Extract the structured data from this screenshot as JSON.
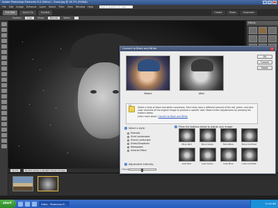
{
  "window": {
    "title": "Adobe Photoshop Elements 8.0 (Editor) - Snow.jpg @ 16.7% (RGB/8)",
    "min": "_",
    "max": "□",
    "close": "x"
  },
  "menu": {
    "items": [
      "File",
      "Edit",
      "Image",
      "Enhance",
      "Layer",
      "Select",
      "Filter",
      "View",
      "Window",
      "Help"
    ],
    "help_placeholder": "Type a question for help"
  },
  "tabs": {
    "full_edit": "Full Edit",
    "quick_fix": "Quick Fix",
    "guided": "Guided",
    "create": "Create",
    "share": "Share",
    "organizer": "Organizer"
  },
  "options": {
    "feather_label": "Feather:",
    "feather_value": "0 px",
    "mode_label": "Mode:",
    "mode_value": "Normal",
    "width_label": "Width:"
  },
  "document": {
    "zoom": "16.7%",
    "info": "39.033 inches x 29.267 inches (72 ppi)"
  },
  "panel": {
    "title": "Effects"
  },
  "dialog": {
    "title": "Convert to Black and White",
    "buttons": {
      "ok": "OK",
      "cancel": "Cancel",
      "reset": "Reset",
      "undo": "Undo",
      "redo": "Redo"
    },
    "before_label": "Before",
    "after_label": "After",
    "tip_label": "Tip",
    "tip_text": "Select a style of black and white conversion. Each style uses a different amount of the red, green, and blue color channels of the original image to produce a specific look. Make further adjustments by pressing the buttons below.",
    "learn_more_prefix": "Learn more about:",
    "learn_more_link": "Convert to Black and White",
    "select_style_title": "Select a style:",
    "styles": [
      "Portraits",
      "Vivid Landscapes",
      "Scenic Landscape",
      "Urban/Snapshots",
      "Newspaper",
      "Infrared Effect"
    ],
    "selected_style_index": 0,
    "adjust_title": "Press the buttons below to adjust your image:",
    "adjust_buttons": [
      "More Red",
      "More Green",
      "More Blue",
      "More Contrast",
      "Less Red",
      "Less Green",
      "Less Blue",
      "Less Contrast"
    ],
    "intensity_title": "Adjustment Intensity:",
    "intensity_label": "Intensity:"
  },
  "taskbar": {
    "start": "start",
    "task_editor": "Editor - Photoshop El...",
    "clock": "11:40 AM"
  },
  "colors": {
    "accent": "#3a6fc8",
    "dialog_bg": "#ececec",
    "title_blue": "#3e4f70"
  }
}
